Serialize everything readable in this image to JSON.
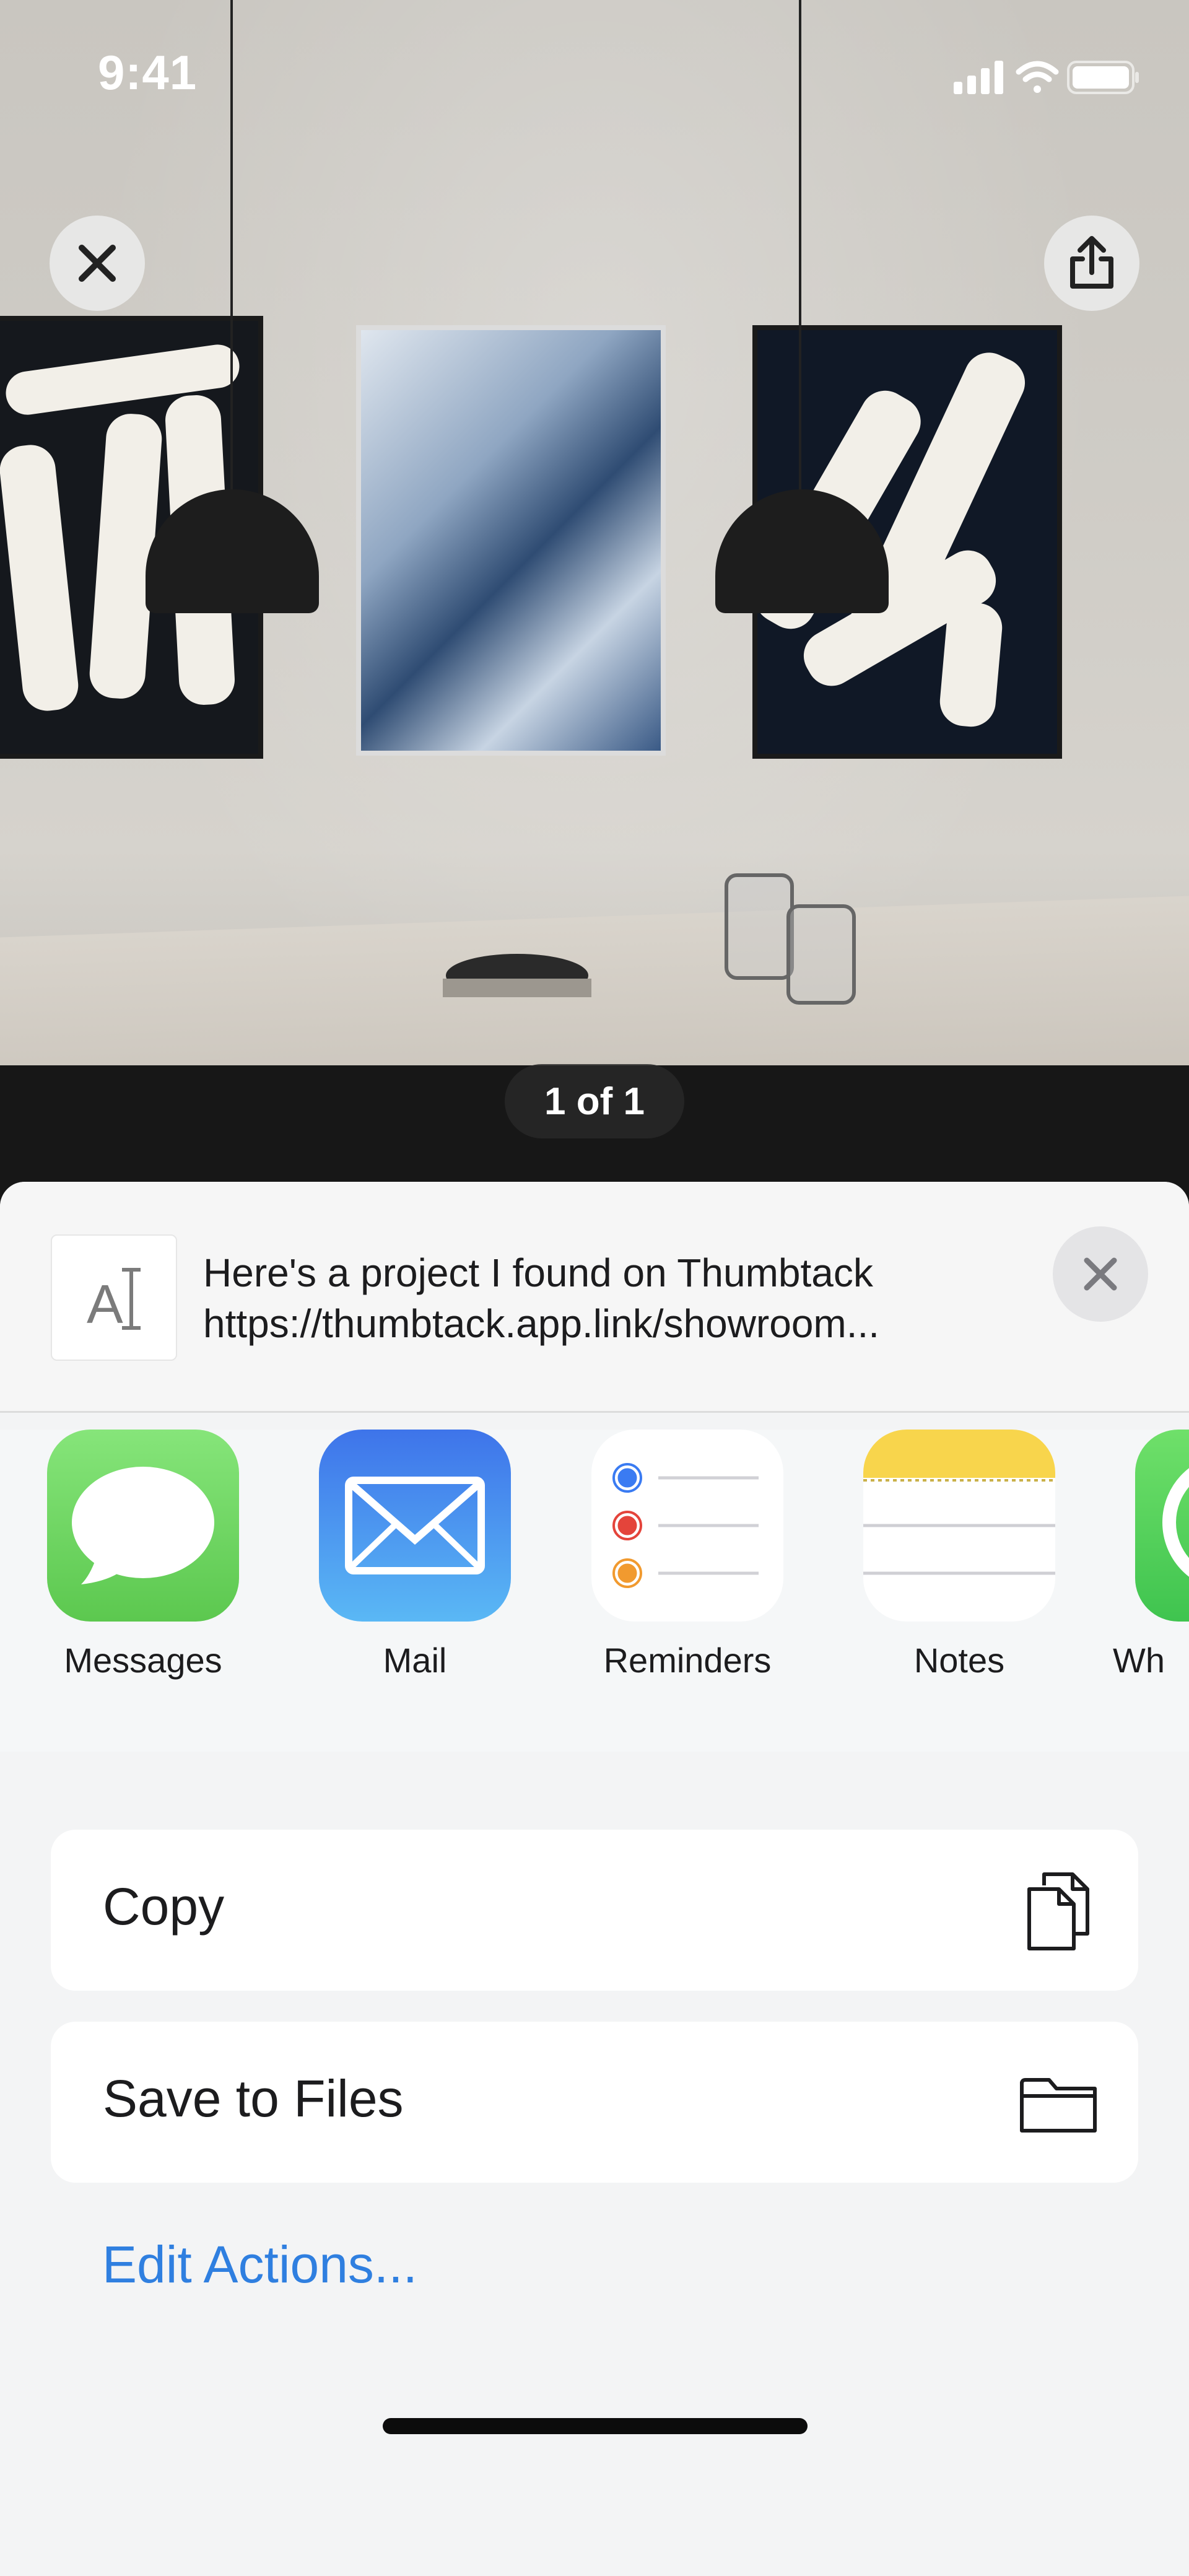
{
  "status_bar": {
    "time": "9:41",
    "signal_icon": "cellular-signal-icon",
    "wifi_icon": "wifi-icon",
    "battery_icon": "battery-icon"
  },
  "photo_viewer": {
    "close_icon": "close-icon",
    "share_icon": "share-icon",
    "counter": "1 of 1"
  },
  "share_sheet": {
    "preview": {
      "thumbnail_icon": "text-document-icon",
      "thumbnail_glyph": "A",
      "title": "Here's a project I found on Thumbtack",
      "url": "https://thumbtack.app.link/showroom..."
    },
    "close_icon": "close-icon",
    "apps": [
      {
        "label": "Messages",
        "icon": "messages-icon",
        "color": "#5cc84f"
      },
      {
        "label": "Mail",
        "icon": "mail-icon",
        "color": "#3a8df0"
      },
      {
        "label": "Reminders",
        "icon": "reminders-icon",
        "color": "#ffffff"
      },
      {
        "label": "Notes",
        "icon": "notes-icon",
        "color": "#f6d14a"
      },
      {
        "label": "Wh",
        "icon": "whatsapp-icon",
        "color": "#4fd05a"
      }
    ],
    "actions": [
      {
        "label": "Copy",
        "icon": "copy-icon"
      },
      {
        "label": "Save to Files",
        "icon": "folder-icon"
      }
    ],
    "edit_actions": "Edit Actions..."
  },
  "colors": {
    "accent": "#2f7fe0",
    "sheet_background": "#f3f4f5"
  }
}
